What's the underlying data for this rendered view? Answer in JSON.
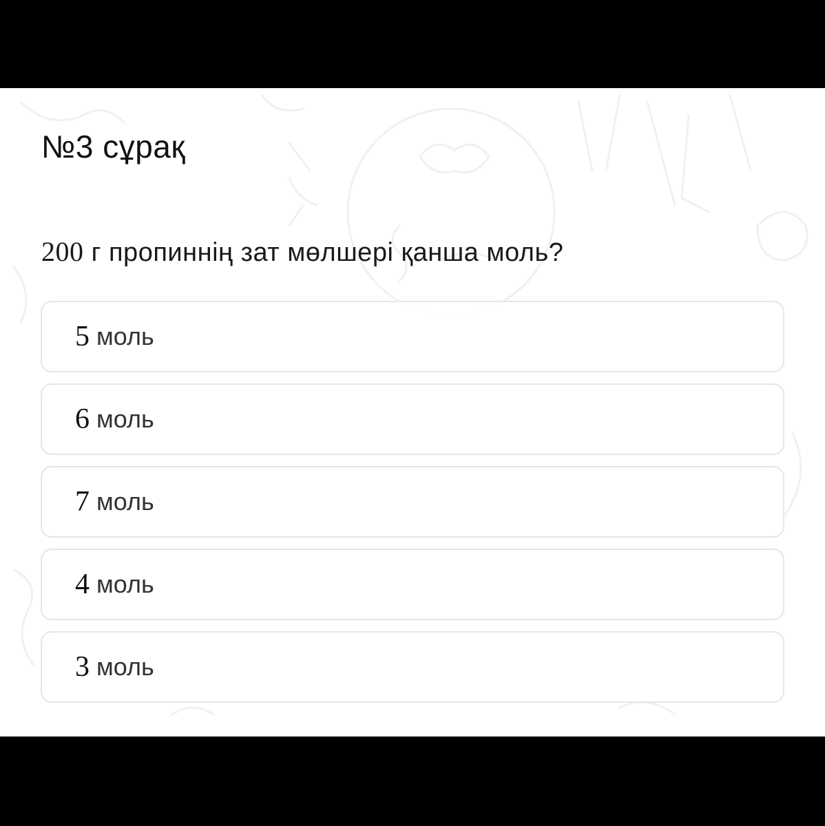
{
  "question": {
    "title": "№3 сұрақ",
    "text_number": "200",
    "text_rest": "г пропиннің зат мөлшері қанша моль?"
  },
  "options": [
    {
      "number": "5",
      "unit": "моль"
    },
    {
      "number": "6",
      "unit": "моль"
    },
    {
      "number": "7",
      "unit": "моль"
    },
    {
      "number": "4",
      "unit": "моль"
    },
    {
      "number": "3",
      "unit": "моль"
    }
  ],
  "colors": {
    "background": "#ffffff",
    "frame": "#000000",
    "option_border": "#e4e6e8",
    "text": "#111111"
  }
}
